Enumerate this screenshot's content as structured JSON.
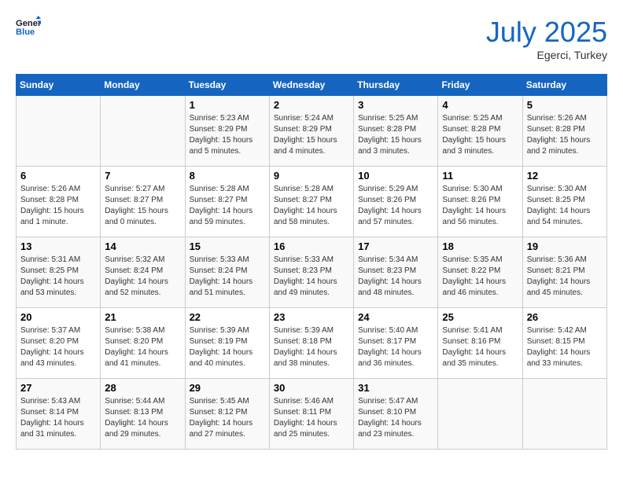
{
  "header": {
    "logo_line1": "General",
    "logo_line2": "Blue",
    "month": "July 2025",
    "location": "Egerci, Turkey"
  },
  "weekdays": [
    "Sunday",
    "Monday",
    "Tuesday",
    "Wednesday",
    "Thursday",
    "Friday",
    "Saturday"
  ],
  "weeks": [
    [
      {
        "day": "",
        "sunrise": "",
        "sunset": "",
        "daylight": ""
      },
      {
        "day": "",
        "sunrise": "",
        "sunset": "",
        "daylight": ""
      },
      {
        "day": "1",
        "sunrise": "Sunrise: 5:23 AM",
        "sunset": "Sunset: 8:29 PM",
        "daylight": "Daylight: 15 hours and 5 minutes."
      },
      {
        "day": "2",
        "sunrise": "Sunrise: 5:24 AM",
        "sunset": "Sunset: 8:29 PM",
        "daylight": "Daylight: 15 hours and 4 minutes."
      },
      {
        "day": "3",
        "sunrise": "Sunrise: 5:25 AM",
        "sunset": "Sunset: 8:28 PM",
        "daylight": "Daylight: 15 hours and 3 minutes."
      },
      {
        "day": "4",
        "sunrise": "Sunrise: 5:25 AM",
        "sunset": "Sunset: 8:28 PM",
        "daylight": "Daylight: 15 hours and 3 minutes."
      },
      {
        "day": "5",
        "sunrise": "Sunrise: 5:26 AM",
        "sunset": "Sunset: 8:28 PM",
        "daylight": "Daylight: 15 hours and 2 minutes."
      }
    ],
    [
      {
        "day": "6",
        "sunrise": "Sunrise: 5:26 AM",
        "sunset": "Sunset: 8:28 PM",
        "daylight": "Daylight: 15 hours and 1 minute."
      },
      {
        "day": "7",
        "sunrise": "Sunrise: 5:27 AM",
        "sunset": "Sunset: 8:27 PM",
        "daylight": "Daylight: 15 hours and 0 minutes."
      },
      {
        "day": "8",
        "sunrise": "Sunrise: 5:28 AM",
        "sunset": "Sunset: 8:27 PM",
        "daylight": "Daylight: 14 hours and 59 minutes."
      },
      {
        "day": "9",
        "sunrise": "Sunrise: 5:28 AM",
        "sunset": "Sunset: 8:27 PM",
        "daylight": "Daylight: 14 hours and 58 minutes."
      },
      {
        "day": "10",
        "sunrise": "Sunrise: 5:29 AM",
        "sunset": "Sunset: 8:26 PM",
        "daylight": "Daylight: 14 hours and 57 minutes."
      },
      {
        "day": "11",
        "sunrise": "Sunrise: 5:30 AM",
        "sunset": "Sunset: 8:26 PM",
        "daylight": "Daylight: 14 hours and 56 minutes."
      },
      {
        "day": "12",
        "sunrise": "Sunrise: 5:30 AM",
        "sunset": "Sunset: 8:25 PM",
        "daylight": "Daylight: 14 hours and 54 minutes."
      }
    ],
    [
      {
        "day": "13",
        "sunrise": "Sunrise: 5:31 AM",
        "sunset": "Sunset: 8:25 PM",
        "daylight": "Daylight: 14 hours and 53 minutes."
      },
      {
        "day": "14",
        "sunrise": "Sunrise: 5:32 AM",
        "sunset": "Sunset: 8:24 PM",
        "daylight": "Daylight: 14 hours and 52 minutes."
      },
      {
        "day": "15",
        "sunrise": "Sunrise: 5:33 AM",
        "sunset": "Sunset: 8:24 PM",
        "daylight": "Daylight: 14 hours and 51 minutes."
      },
      {
        "day": "16",
        "sunrise": "Sunrise: 5:33 AM",
        "sunset": "Sunset: 8:23 PM",
        "daylight": "Daylight: 14 hours and 49 minutes."
      },
      {
        "day": "17",
        "sunrise": "Sunrise: 5:34 AM",
        "sunset": "Sunset: 8:23 PM",
        "daylight": "Daylight: 14 hours and 48 minutes."
      },
      {
        "day": "18",
        "sunrise": "Sunrise: 5:35 AM",
        "sunset": "Sunset: 8:22 PM",
        "daylight": "Daylight: 14 hours and 46 minutes."
      },
      {
        "day": "19",
        "sunrise": "Sunrise: 5:36 AM",
        "sunset": "Sunset: 8:21 PM",
        "daylight": "Daylight: 14 hours and 45 minutes."
      }
    ],
    [
      {
        "day": "20",
        "sunrise": "Sunrise: 5:37 AM",
        "sunset": "Sunset: 8:20 PM",
        "daylight": "Daylight: 14 hours and 43 minutes."
      },
      {
        "day": "21",
        "sunrise": "Sunrise: 5:38 AM",
        "sunset": "Sunset: 8:20 PM",
        "daylight": "Daylight: 14 hours and 41 minutes."
      },
      {
        "day": "22",
        "sunrise": "Sunrise: 5:39 AM",
        "sunset": "Sunset: 8:19 PM",
        "daylight": "Daylight: 14 hours and 40 minutes."
      },
      {
        "day": "23",
        "sunrise": "Sunrise: 5:39 AM",
        "sunset": "Sunset: 8:18 PM",
        "daylight": "Daylight: 14 hours and 38 minutes."
      },
      {
        "day": "24",
        "sunrise": "Sunrise: 5:40 AM",
        "sunset": "Sunset: 8:17 PM",
        "daylight": "Daylight: 14 hours and 36 minutes."
      },
      {
        "day": "25",
        "sunrise": "Sunrise: 5:41 AM",
        "sunset": "Sunset: 8:16 PM",
        "daylight": "Daylight: 14 hours and 35 minutes."
      },
      {
        "day": "26",
        "sunrise": "Sunrise: 5:42 AM",
        "sunset": "Sunset: 8:15 PM",
        "daylight": "Daylight: 14 hours and 33 minutes."
      }
    ],
    [
      {
        "day": "27",
        "sunrise": "Sunrise: 5:43 AM",
        "sunset": "Sunset: 8:14 PM",
        "daylight": "Daylight: 14 hours and 31 minutes."
      },
      {
        "day": "28",
        "sunrise": "Sunrise: 5:44 AM",
        "sunset": "Sunset: 8:13 PM",
        "daylight": "Daylight: 14 hours and 29 minutes."
      },
      {
        "day": "29",
        "sunrise": "Sunrise: 5:45 AM",
        "sunset": "Sunset: 8:12 PM",
        "daylight": "Daylight: 14 hours and 27 minutes."
      },
      {
        "day": "30",
        "sunrise": "Sunrise: 5:46 AM",
        "sunset": "Sunset: 8:11 PM",
        "daylight": "Daylight: 14 hours and 25 minutes."
      },
      {
        "day": "31",
        "sunrise": "Sunrise: 5:47 AM",
        "sunset": "Sunset: 8:10 PM",
        "daylight": "Daylight: 14 hours and 23 minutes."
      },
      {
        "day": "",
        "sunrise": "",
        "sunset": "",
        "daylight": ""
      },
      {
        "day": "",
        "sunrise": "",
        "sunset": "",
        "daylight": ""
      }
    ]
  ]
}
